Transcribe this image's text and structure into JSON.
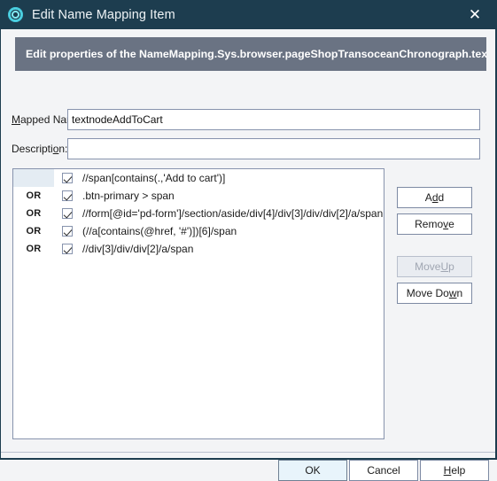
{
  "window": {
    "title": "Edit Name Mapping Item",
    "icon": "app-gear-icon",
    "close_label": "✕",
    "titlebar_color": "#1d3d4f"
  },
  "banner": {
    "text": "Edit properties of the NameMapping.Sys.browser.pageShopTransoceanChronograph.textno",
    "background": "#6a7383"
  },
  "fields": {
    "mapped_name": {
      "label_pre": "",
      "label_accel": "M",
      "label_post": "apped Name:",
      "value": "textnodeAddToCart",
      "placeholder": ""
    },
    "description": {
      "label_pre": "Descripti",
      "label_accel": "o",
      "label_post": "n:",
      "value": "",
      "placeholder": ""
    }
  },
  "list": {
    "rows": [
      {
        "operator": "",
        "checked": true,
        "expression": "//span[contains(.,'Add to cart')]"
      },
      {
        "operator": "OR",
        "checked": true,
        "expression": ".btn-primary > span"
      },
      {
        "operator": "OR",
        "checked": true,
        "expression": "//form[@id='pd-form']/section/aside/div[4]/div[3]/div/div[2]/a/span"
      },
      {
        "operator": "OR",
        "checked": true,
        "expression": "(//a[contains(@href, '#')])[6]/span"
      },
      {
        "operator": "OR",
        "checked": true,
        "expression": "//div[3]/div/div[2]/a/span"
      }
    ]
  },
  "side_buttons": {
    "add": {
      "pre": "A",
      "accel": "d",
      "post": "d",
      "disabled": false
    },
    "remove": {
      "pre": "Remo",
      "accel": "v",
      "post": "e",
      "disabled": false
    },
    "move_up": {
      "pre": "Move ",
      "accel": "U",
      "post": "p",
      "disabled": true
    },
    "move_down": {
      "pre": "Move Do",
      "accel": "w",
      "post": "n",
      "disabled": false
    }
  },
  "footer_buttons": {
    "ok": {
      "label": "OK",
      "default": true
    },
    "cancel": {
      "label": "Cancel",
      "default": false
    },
    "help": {
      "pre": "",
      "accel": "H",
      "post": "elp",
      "default": false
    }
  }
}
